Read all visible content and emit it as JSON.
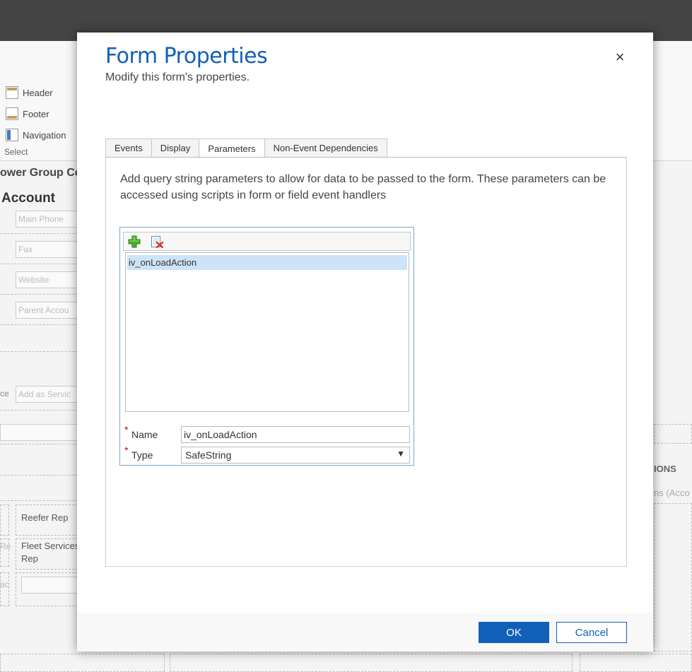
{
  "background": {
    "ribbon": {
      "items": [
        {
          "label": "Header",
          "icon": "header-layout-icon"
        },
        {
          "label": "Footer",
          "icon": "footer-layout-icon"
        },
        {
          "label": "Navigation",
          "icon": "navigation-layout-icon"
        }
      ],
      "group_label": "Select"
    },
    "subtitle": "ower Group Co",
    "entity": "Account",
    "fields": [
      "Main Phone",
      "Fax",
      "Website",
      "Parent Accou",
      "Add as Servic"
    ],
    "side_label_fragment": "ce",
    "labels": {
      "reefer": "Reefer Rep",
      "fleet_line1": "Fleet Services",
      "fleet_line2": "Rep",
      "left_frag1": "Re",
      "left_frag2": "ac"
    },
    "right_section": "IONS",
    "right_sub": "ns (Acco"
  },
  "dialog": {
    "title": "Form Properties",
    "subtitle": "Modify this form's properties.",
    "tabs": [
      {
        "label": "Events",
        "active": false
      },
      {
        "label": "Display",
        "active": false
      },
      {
        "label": "Parameters",
        "active": true
      },
      {
        "label": "Non-Event Dependencies",
        "active": false
      }
    ],
    "description": "Add query string parameters to allow for data to be passed to the form. These parameters can be accessed using scripts in form or field event handlers",
    "parameters": {
      "items": [
        "iv_onLoadAction"
      ],
      "selected": "iv_onLoadAction"
    },
    "name_field": {
      "label": "Name",
      "value": "iv_onLoadAction",
      "required": true
    },
    "type_field": {
      "label": "Type",
      "value": "SafeString",
      "required": true
    },
    "ok_label": "OK",
    "cancel_label": "Cancel",
    "close_glyph": "×"
  },
  "colors": {
    "accent": "#1160b7",
    "selection": "#cde3f8",
    "required": "#cc0000",
    "topbar": "#444444"
  }
}
